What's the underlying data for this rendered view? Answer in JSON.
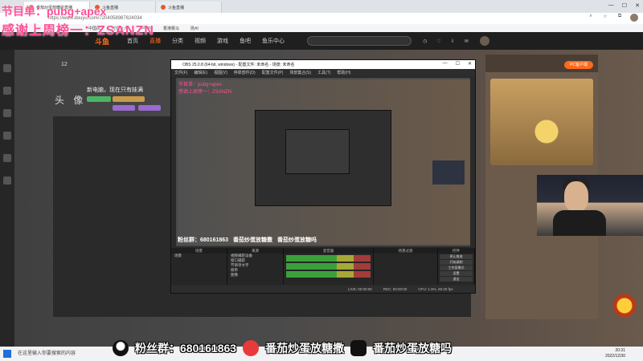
{
  "overlay": {
    "line1": "节目单：pubg+apex",
    "line2": "感谢上周榜一：ZSANZN"
  },
  "browser": {
    "tabs": [
      {
        "label": "番茄炒蛋放糖的直播"
      },
      {
        "label": "斗鱼直播"
      },
      {
        "label": "斗鱼直播"
      }
    ],
    "address": "https://www.douyu.com/7204058987624034",
    "bookmarks": [
      "中国风",
      "可爱女人",
      "5EPlay",
      "香港赛马",
      "扬州"
    ],
    "window_controls": [
      "—",
      "☐",
      "✕"
    ],
    "right_icons": [
      "search-icon",
      "star-icon",
      "extensions-icon",
      "profile-icon"
    ]
  },
  "site": {
    "logo": "斗鱼",
    "nav": [
      "首页",
      "直播",
      "分类",
      "视频",
      "游戏",
      "鱼吧",
      "鱼乐中心"
    ],
    "active_nav": "直播",
    "icons": [
      "history-icon",
      "follow-icon",
      "download-icon",
      "message-icon"
    ]
  },
  "room": {
    "number": "12",
    "title": "新电脑，现在只有娃满",
    "headimg_label": "头 像",
    "button": "PC客户端"
  },
  "obs": {
    "title": "OBS 25.0.8 (64-bit, windows) - 配置文件: 未命名 - 场景: 未命名",
    "menu": [
      "文件(F)",
      "编辑(E)",
      "视图(V)",
      "停靠部件(D)",
      "配置文件(P)",
      "场景集合(S)",
      "工具(T)",
      "帮助(H)"
    ],
    "overlay_line1": "节目单：pubg+apex",
    "overlay_line2": "感谢上周榜一：ZSANZN",
    "banner": [
      "粉丝群：680161863",
      "番茄炒蛋放糖撒",
      "番茄炒蛋放糖吗"
    ],
    "docks": {
      "scenes_title": "场景",
      "scenes": [
        "场景"
      ],
      "sources_title": "来源",
      "sources": [
        "视频捕获设备",
        "窗口捕获",
        "节目单文字",
        "榜单",
        "图像"
      ],
      "mixer_title": "混音器",
      "transitions_title": "场景过渡",
      "controls_title": "控件",
      "controls": [
        "停止推流",
        "开始录制",
        "工作室模式",
        "设置",
        "退出"
      ]
    },
    "status": [
      "LIVE: 00:00:00",
      "REC: 00:00:00",
      "CPU: 1.9%, 60.00 fps"
    ]
  },
  "bottom_banner": {
    "qq_group": "粉丝群：680161863",
    "tomato_name": "番茄炒蛋放糖撒",
    "tiktok_name": "番茄炒蛋放糖吗"
  },
  "taskbar": {
    "search_placeholder": "在这里输入你要搜索的内容",
    "time": "20:31",
    "date": "2022/12/30"
  }
}
